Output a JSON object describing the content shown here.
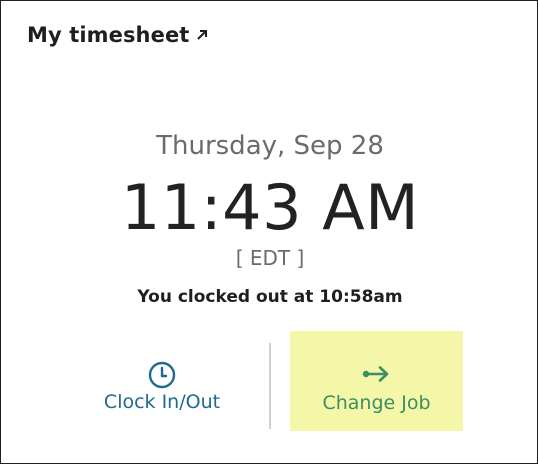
{
  "header": {
    "title": "My timesheet",
    "link_icon": "external-link-arrow-icon"
  },
  "clock": {
    "date": "Thursday, Sep 28",
    "time": "11:43 AM",
    "timezone": "[ EDT ]",
    "status": "You clocked out at 10:58am"
  },
  "actions": {
    "clock_in_out": {
      "label": "Clock In/Out",
      "icon": "clock-icon",
      "color": "#1f6b8e"
    },
    "change_job": {
      "label": "Change Job",
      "icon": "arrow-right-icon",
      "color": "#3a8f63",
      "highlight": "#f4f7a8"
    }
  }
}
